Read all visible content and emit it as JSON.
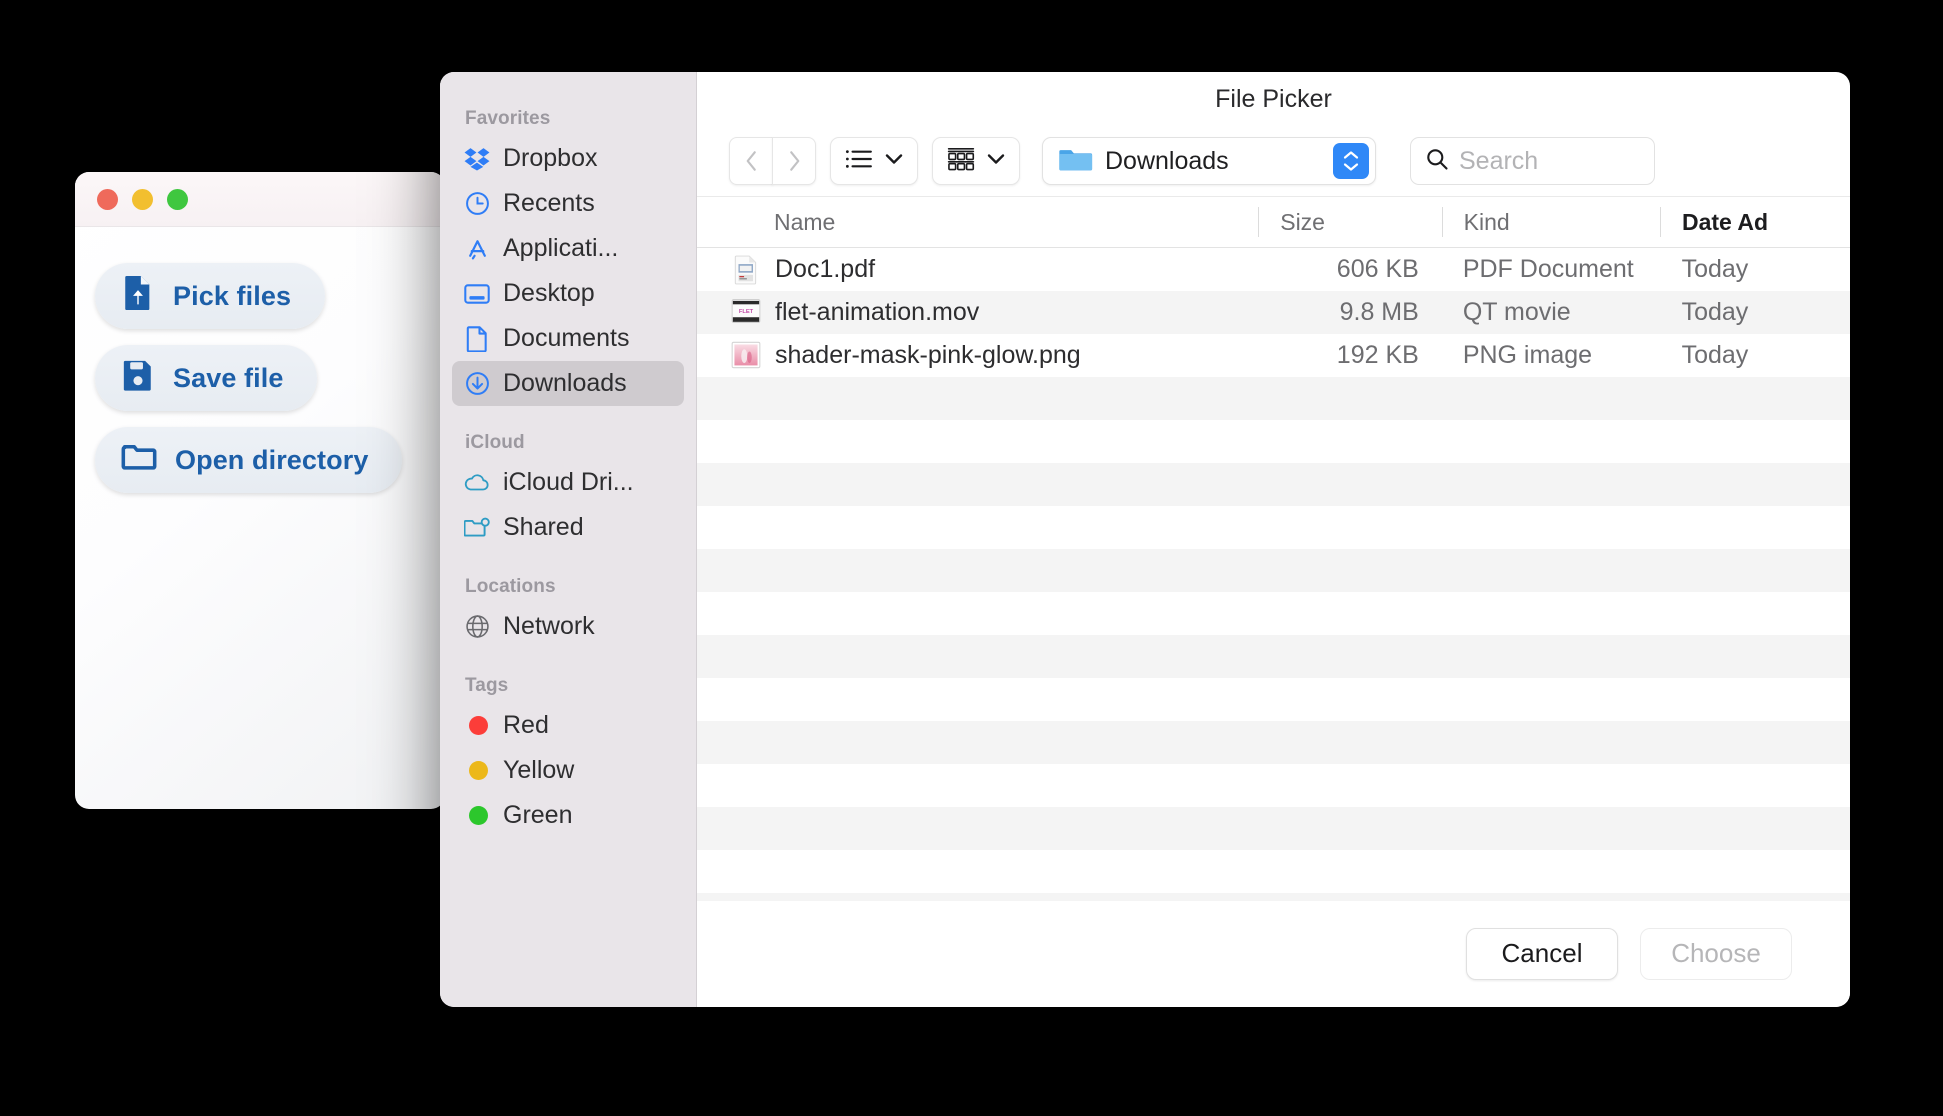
{
  "app_window": {
    "traffic_lights": [
      {
        "name": "close",
        "color": "#ef6a5b"
      },
      {
        "name": "minimize",
        "color": "#f2bf2f"
      },
      {
        "name": "zoom",
        "color": "#3fc73f"
      }
    ],
    "buttons": [
      {
        "label": "Pick files",
        "icon": "file-upload-icon"
      },
      {
        "label": "Save file",
        "icon": "floppy-disk-icon"
      },
      {
        "label": "Open directory",
        "icon": "folder-icon"
      }
    ],
    "accent_color": "#1d5fa8"
  },
  "dialog": {
    "title": "File Picker",
    "sidebar": {
      "sections": [
        {
          "header": "Favorites",
          "items": [
            {
              "label": "Dropbox",
              "icon": "dropbox-icon",
              "selected": false
            },
            {
              "label": "Recents",
              "icon": "clock-icon",
              "selected": false
            },
            {
              "label": "Applicati...",
              "icon": "app-store-icon",
              "selected": false
            },
            {
              "label": "Desktop",
              "icon": "desktop-icon",
              "selected": false
            },
            {
              "label": "Documents",
              "icon": "document-icon",
              "selected": false
            },
            {
              "label": "Downloads",
              "icon": "download-icon",
              "selected": true
            }
          ]
        },
        {
          "header": "iCloud",
          "items": [
            {
              "label": "iCloud Dri...",
              "icon": "cloud-icon",
              "selected": false
            },
            {
              "label": "Shared",
              "icon": "shared-folder-icon",
              "selected": false
            }
          ]
        },
        {
          "header": "Locations",
          "items": [
            {
              "label": "Network",
              "icon": "globe-icon",
              "selected": false
            }
          ]
        },
        {
          "header": "Tags",
          "items": [
            {
              "label": "Red",
              "icon": "tag-dot-icon",
              "color": "#fc3d39",
              "selected": false
            },
            {
              "label": "Yellow",
              "icon": "tag-dot-icon",
              "color": "#ecb81a",
              "selected": false
            },
            {
              "label": "Green",
              "icon": "tag-dot-icon",
              "color": "#2cc72c",
              "selected": false
            }
          ]
        }
      ]
    },
    "toolbar": {
      "back_icon": "chevron-left-icon",
      "forward_icon": "chevron-right-icon",
      "list_view_icon": "list-view-icon",
      "list_view_chevron": "chevron-down-icon",
      "group_view_icon": "group-view-icon",
      "group_view_chevron": "chevron-down-icon",
      "path_icon": "folder-icon",
      "path_label": "Downloads",
      "path_stepper_icon": "up-down-stepper-icon",
      "stepper_color": "#2f88f7",
      "search_icon": "search-icon",
      "search_placeholder": "Search",
      "search_value": ""
    },
    "file_list": {
      "columns": [
        {
          "key": "name",
          "label": "Name",
          "sorted": false
        },
        {
          "key": "size",
          "label": "Size",
          "sorted": false
        },
        {
          "key": "kind",
          "label": "Kind",
          "sorted": false
        },
        {
          "key": "date",
          "label": "Date Ad",
          "sorted": true
        }
      ],
      "rows": [
        {
          "name": "Doc1.pdf",
          "size": "606 KB",
          "kind": "PDF Document",
          "date": "Today",
          "icon": "pdf-file-icon"
        },
        {
          "name": "flet-animation.mov",
          "size": "9.8 MB",
          "kind": "QT movie",
          "date": "Today",
          "icon": "movie-file-icon"
        },
        {
          "name": "shader-mask-pink-glow.png",
          "size": "192 KB",
          "kind": "PNG image",
          "date": "Today",
          "icon": "png-file-icon"
        }
      ],
      "empty_row_count": 14
    },
    "footer": {
      "cancel_label": "Cancel",
      "choose_label": "Choose",
      "choose_disabled": true
    }
  }
}
